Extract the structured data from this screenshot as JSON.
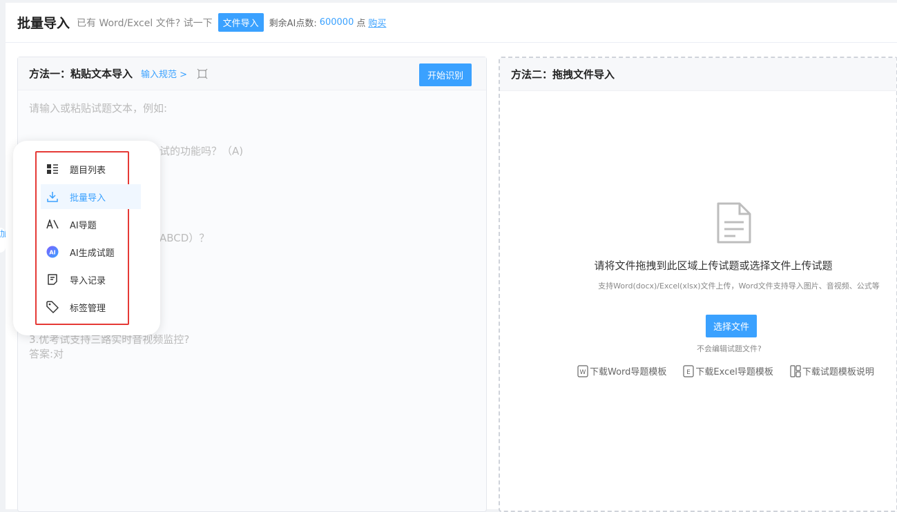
{
  "header": {
    "title": "批量导入",
    "hint": "已有 Word/Excel 文件? 试一下",
    "file_import_button": "文件导入",
    "points_label": "剩余AI点数:",
    "points_value": "600000",
    "points_unit": "点",
    "buy_link": "购买"
  },
  "left_panel": {
    "title": "方法一：粘贴文本导入",
    "rule_link": "输入规范 >",
    "start_button": "开始识别",
    "placeholder_lines": [
      "请输入或粘贴试题文本，例如:",
      "试的功能吗？（A)",
      "ABCD）？",
      "3.优考试支持三路实时音视频监控?",
      "答案:对"
    ]
  },
  "side_menu": {
    "items": [
      {
        "label": "题目列表",
        "icon": "list-icon"
      },
      {
        "label": "批量导入",
        "icon": "download-icon"
      },
      {
        "label": "AI导题",
        "icon": "ai-text-icon"
      },
      {
        "label": "AI生成试题",
        "icon": "ai-badge-icon"
      },
      {
        "label": "导入记录",
        "icon": "record-icon"
      },
      {
        "label": "标签管理",
        "icon": "tag-icon"
      }
    ],
    "active_index": 1,
    "edge_tab_text": "加"
  },
  "right_panel": {
    "title": "方法二：拖拽文件导入",
    "drop_title": "请将文件拖拽到此区域上传试题或选择文件上传试题",
    "drop_subtitle": "支持Word(docx)/Excel(xlsx)文件上传，Word文件支持导入图片、音视频、公式等",
    "choose_button": "选择文件",
    "no_edit_text": "不会编辑试题文件?",
    "downloads": [
      {
        "label": "下载Word导题模板",
        "icon": "word-icon"
      },
      {
        "label": "下载Excel导题模板",
        "icon": "excel-icon"
      },
      {
        "label": "下载试题模板说明",
        "icon": "template-icon"
      }
    ]
  },
  "colors": {
    "accent": "#3aa1ff",
    "highlight_border": "#e53935"
  }
}
